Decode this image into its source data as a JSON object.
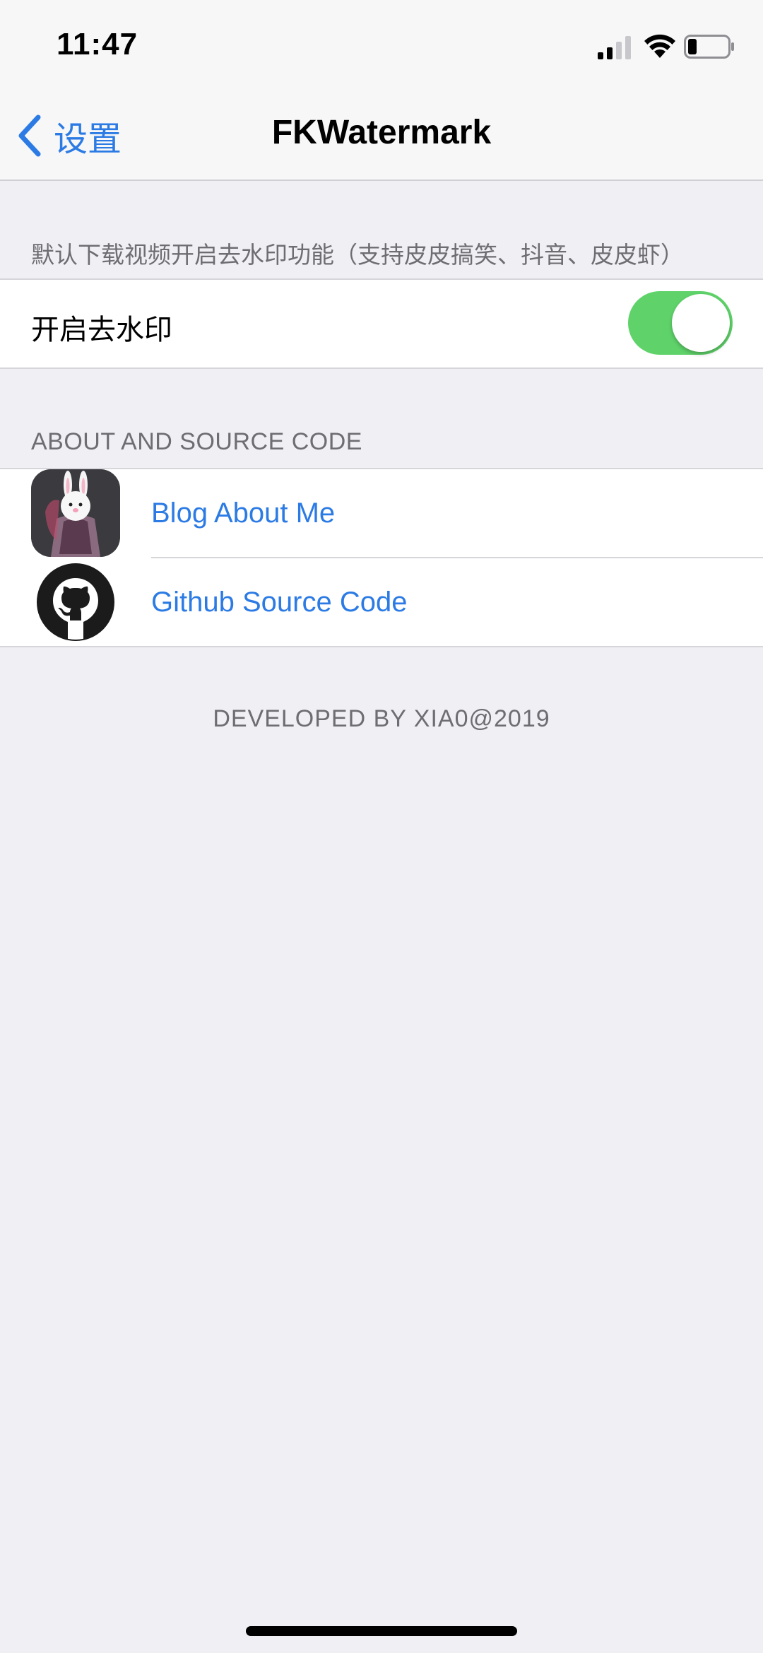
{
  "status_bar": {
    "time": "11:47",
    "icons": [
      "signal-icon",
      "wifi-icon",
      "battery-icon"
    ]
  },
  "nav": {
    "back_label": "设置",
    "back_icon": "chevron-left-icon",
    "title": "FKWatermark"
  },
  "section_watermark": {
    "header": "默认下载视频开启去水印功能（支持皮皮搞笑、抖音、皮皮虾）",
    "toggle_label": "开启去水印",
    "toggle_on": true
  },
  "section_about": {
    "header": "ABOUT AND SOURCE CODE",
    "items": [
      {
        "label": "Blog About Me",
        "icon": "bunny-avatar-icon"
      },
      {
        "label": "Github Source Code",
        "icon": "github-icon"
      }
    ]
  },
  "footer": "DEVELOPED BY XIA0@2019",
  "colors": {
    "background": "#efeff4",
    "link": "#2c7be5",
    "toggle_on": "#5fd36a",
    "header_text": "#6d6d72"
  }
}
